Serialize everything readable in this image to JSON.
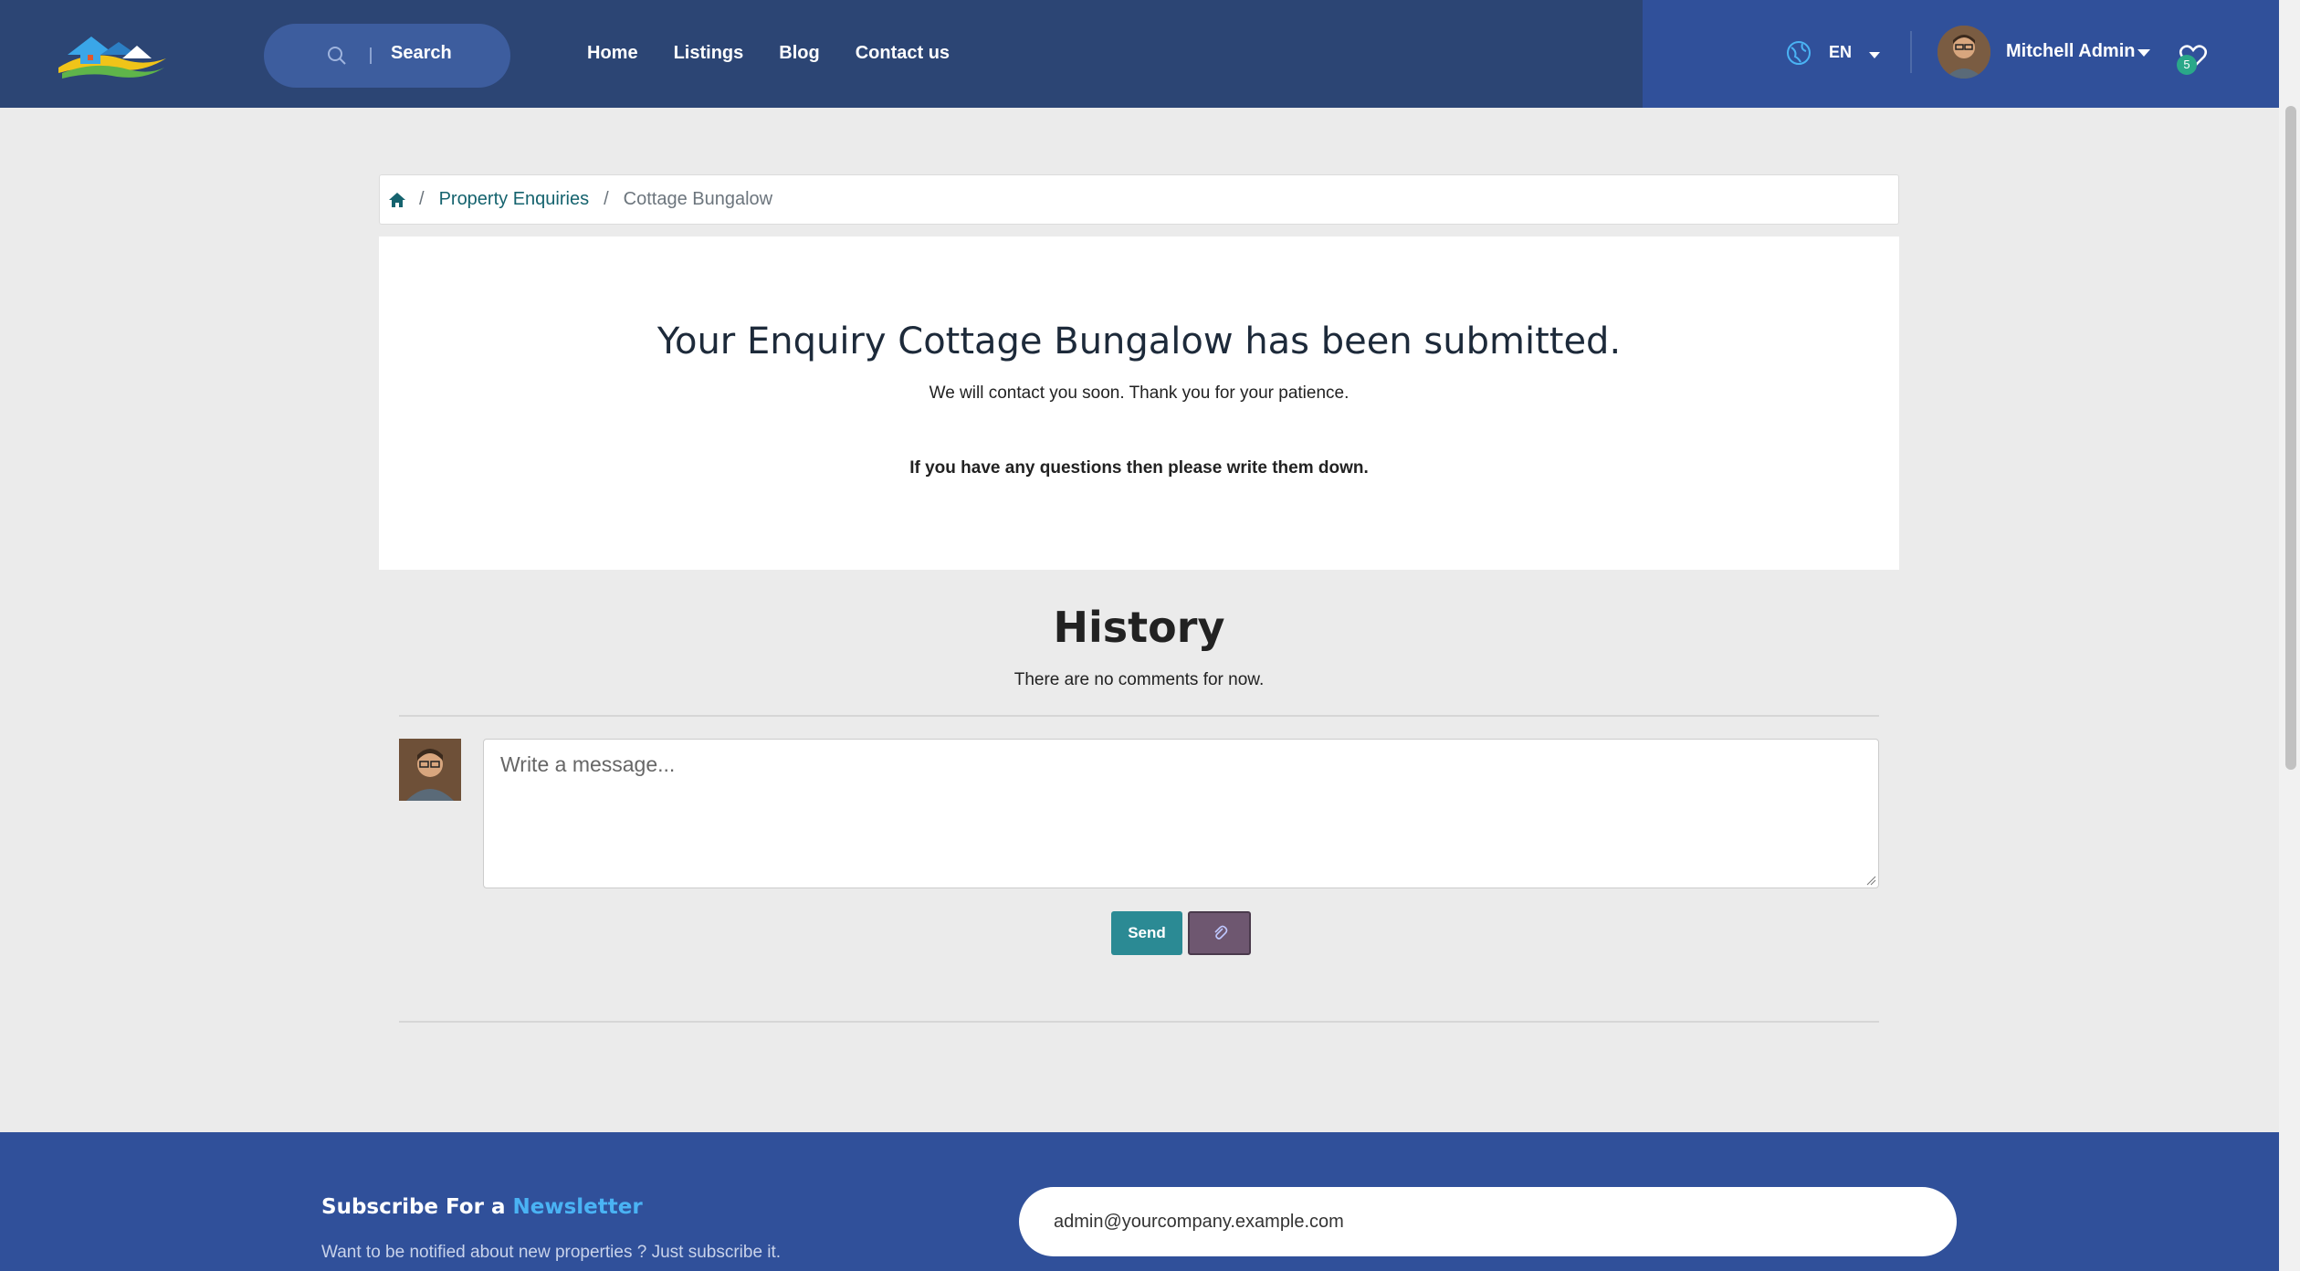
{
  "header": {
    "search_label": "Search",
    "nav": [
      "Home",
      "Listings",
      "Blog",
      "Contact us"
    ],
    "language": "EN",
    "user_name": "Mitchell Admin",
    "wishlist_count": "5"
  },
  "breadcrumb": {
    "parent": "Property Enquiries",
    "sep": "/",
    "current": "Cottage Bungalow"
  },
  "confirmation": {
    "title": "Your Enquiry Cottage Bungalow has been submitted.",
    "subtitle": "We will contact you soon. Thank you for your patience.",
    "question_note": "If you have any questions then please write them down."
  },
  "history": {
    "title": "History",
    "empty_text": "There are no comments for now.",
    "message_placeholder": "Write a message...",
    "send_label": "Send",
    "attach_icon": "paperclip-icon"
  },
  "footer": {
    "newsletter_prefix": "Subscribe For a",
    "newsletter_highlight": "Newsletter",
    "newsletter_sub": "Want to be notified about new properties ? Just subscribe it.",
    "email_value": "admin@yourcompany.example.com"
  },
  "colors": {
    "header_bg": "#2c4574",
    "header_right_bg": "#30509a",
    "footer_bg": "#30509a",
    "accent_teal": "#2b8a94",
    "link": "#15636e",
    "highlight": "#4ab3f4"
  }
}
